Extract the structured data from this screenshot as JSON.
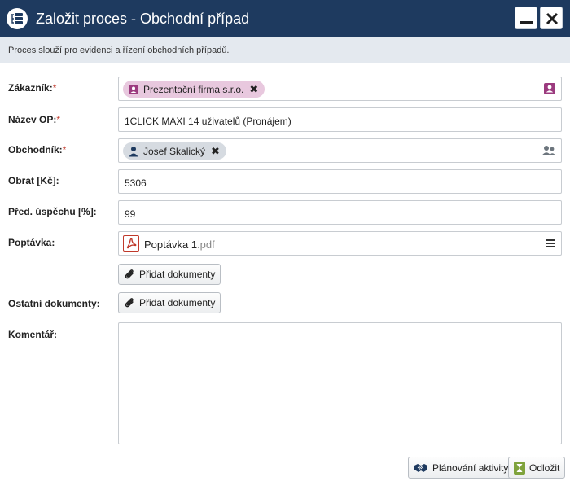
{
  "window": {
    "title": "Založit proces - Obchodní případ",
    "description": "Proces slouží pro evidenci a řízení obchodních případů."
  },
  "form": {
    "zakaznik": {
      "label": "Zákazník:",
      "required_mark": "*",
      "chip": "Prezentační firma s.r.o."
    },
    "nazev_op": {
      "label": "Název OP:",
      "required_mark": "*",
      "value": "1CLICK MAXI 14 uživatelů (Pronájem)"
    },
    "obchodnik": {
      "label": "Obchodník:",
      "required_mark": "*",
      "chip": "Josef Skalický"
    },
    "obrat": {
      "label": "Obrat [Kč]:",
      "value": "5306"
    },
    "pred_uspechu": {
      "label": "Před. úspěchu [%]:",
      "value": "99"
    },
    "poptavka": {
      "label": "Poptávka:",
      "doc_name": "Poptávka 1",
      "doc_ext": ".pdf",
      "add_button": "Přidat dokumenty"
    },
    "ostatni": {
      "label": "Ostatní dokumenty:",
      "add_button": "Přidat dokumenty"
    },
    "komentar": {
      "label": "Komentář:",
      "value": ""
    }
  },
  "footer": {
    "planning_button": "Plánování aktivity",
    "postpone_button": "Odložit"
  },
  "colors": {
    "titlebar": "#1e3a5f",
    "chip_customer": "#e8c8de",
    "chip_user": "#d6dbe1",
    "required": "#c0392b"
  }
}
